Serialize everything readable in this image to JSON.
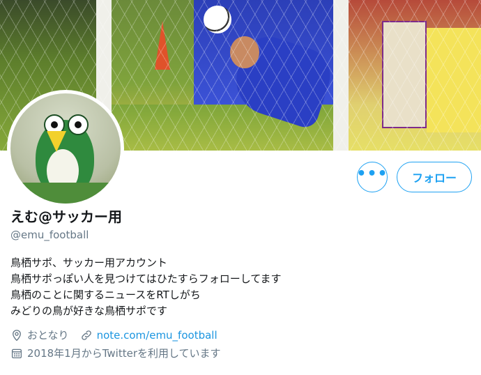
{
  "profile": {
    "display_name": "えむ@サッカー用",
    "handle": "@emu_football",
    "bio_lines": [
      "鳥栖サポ、サッカー用アカウント",
      "鳥栖サポっぽい人を見つけてはひたすらフォローしてます",
      "鳥栖のことに関するニュースをRTしがち",
      "みどりの鳥が好きな鳥栖サポです"
    ],
    "location": "おとなり",
    "website": "note.com/emu_football",
    "joined": "2018年1月からTwitterを利用しています"
  },
  "actions": {
    "more_label": "•••",
    "follow_label": "フォロー"
  },
  "colors": {
    "accent": "#1da1f2",
    "link": "#1b95e0",
    "secondary_text": "#657786",
    "primary_text": "#14171a"
  },
  "icons": {
    "more": "more-icon",
    "location": "location-pin-icon",
    "link": "link-icon",
    "calendar": "calendar-icon"
  }
}
